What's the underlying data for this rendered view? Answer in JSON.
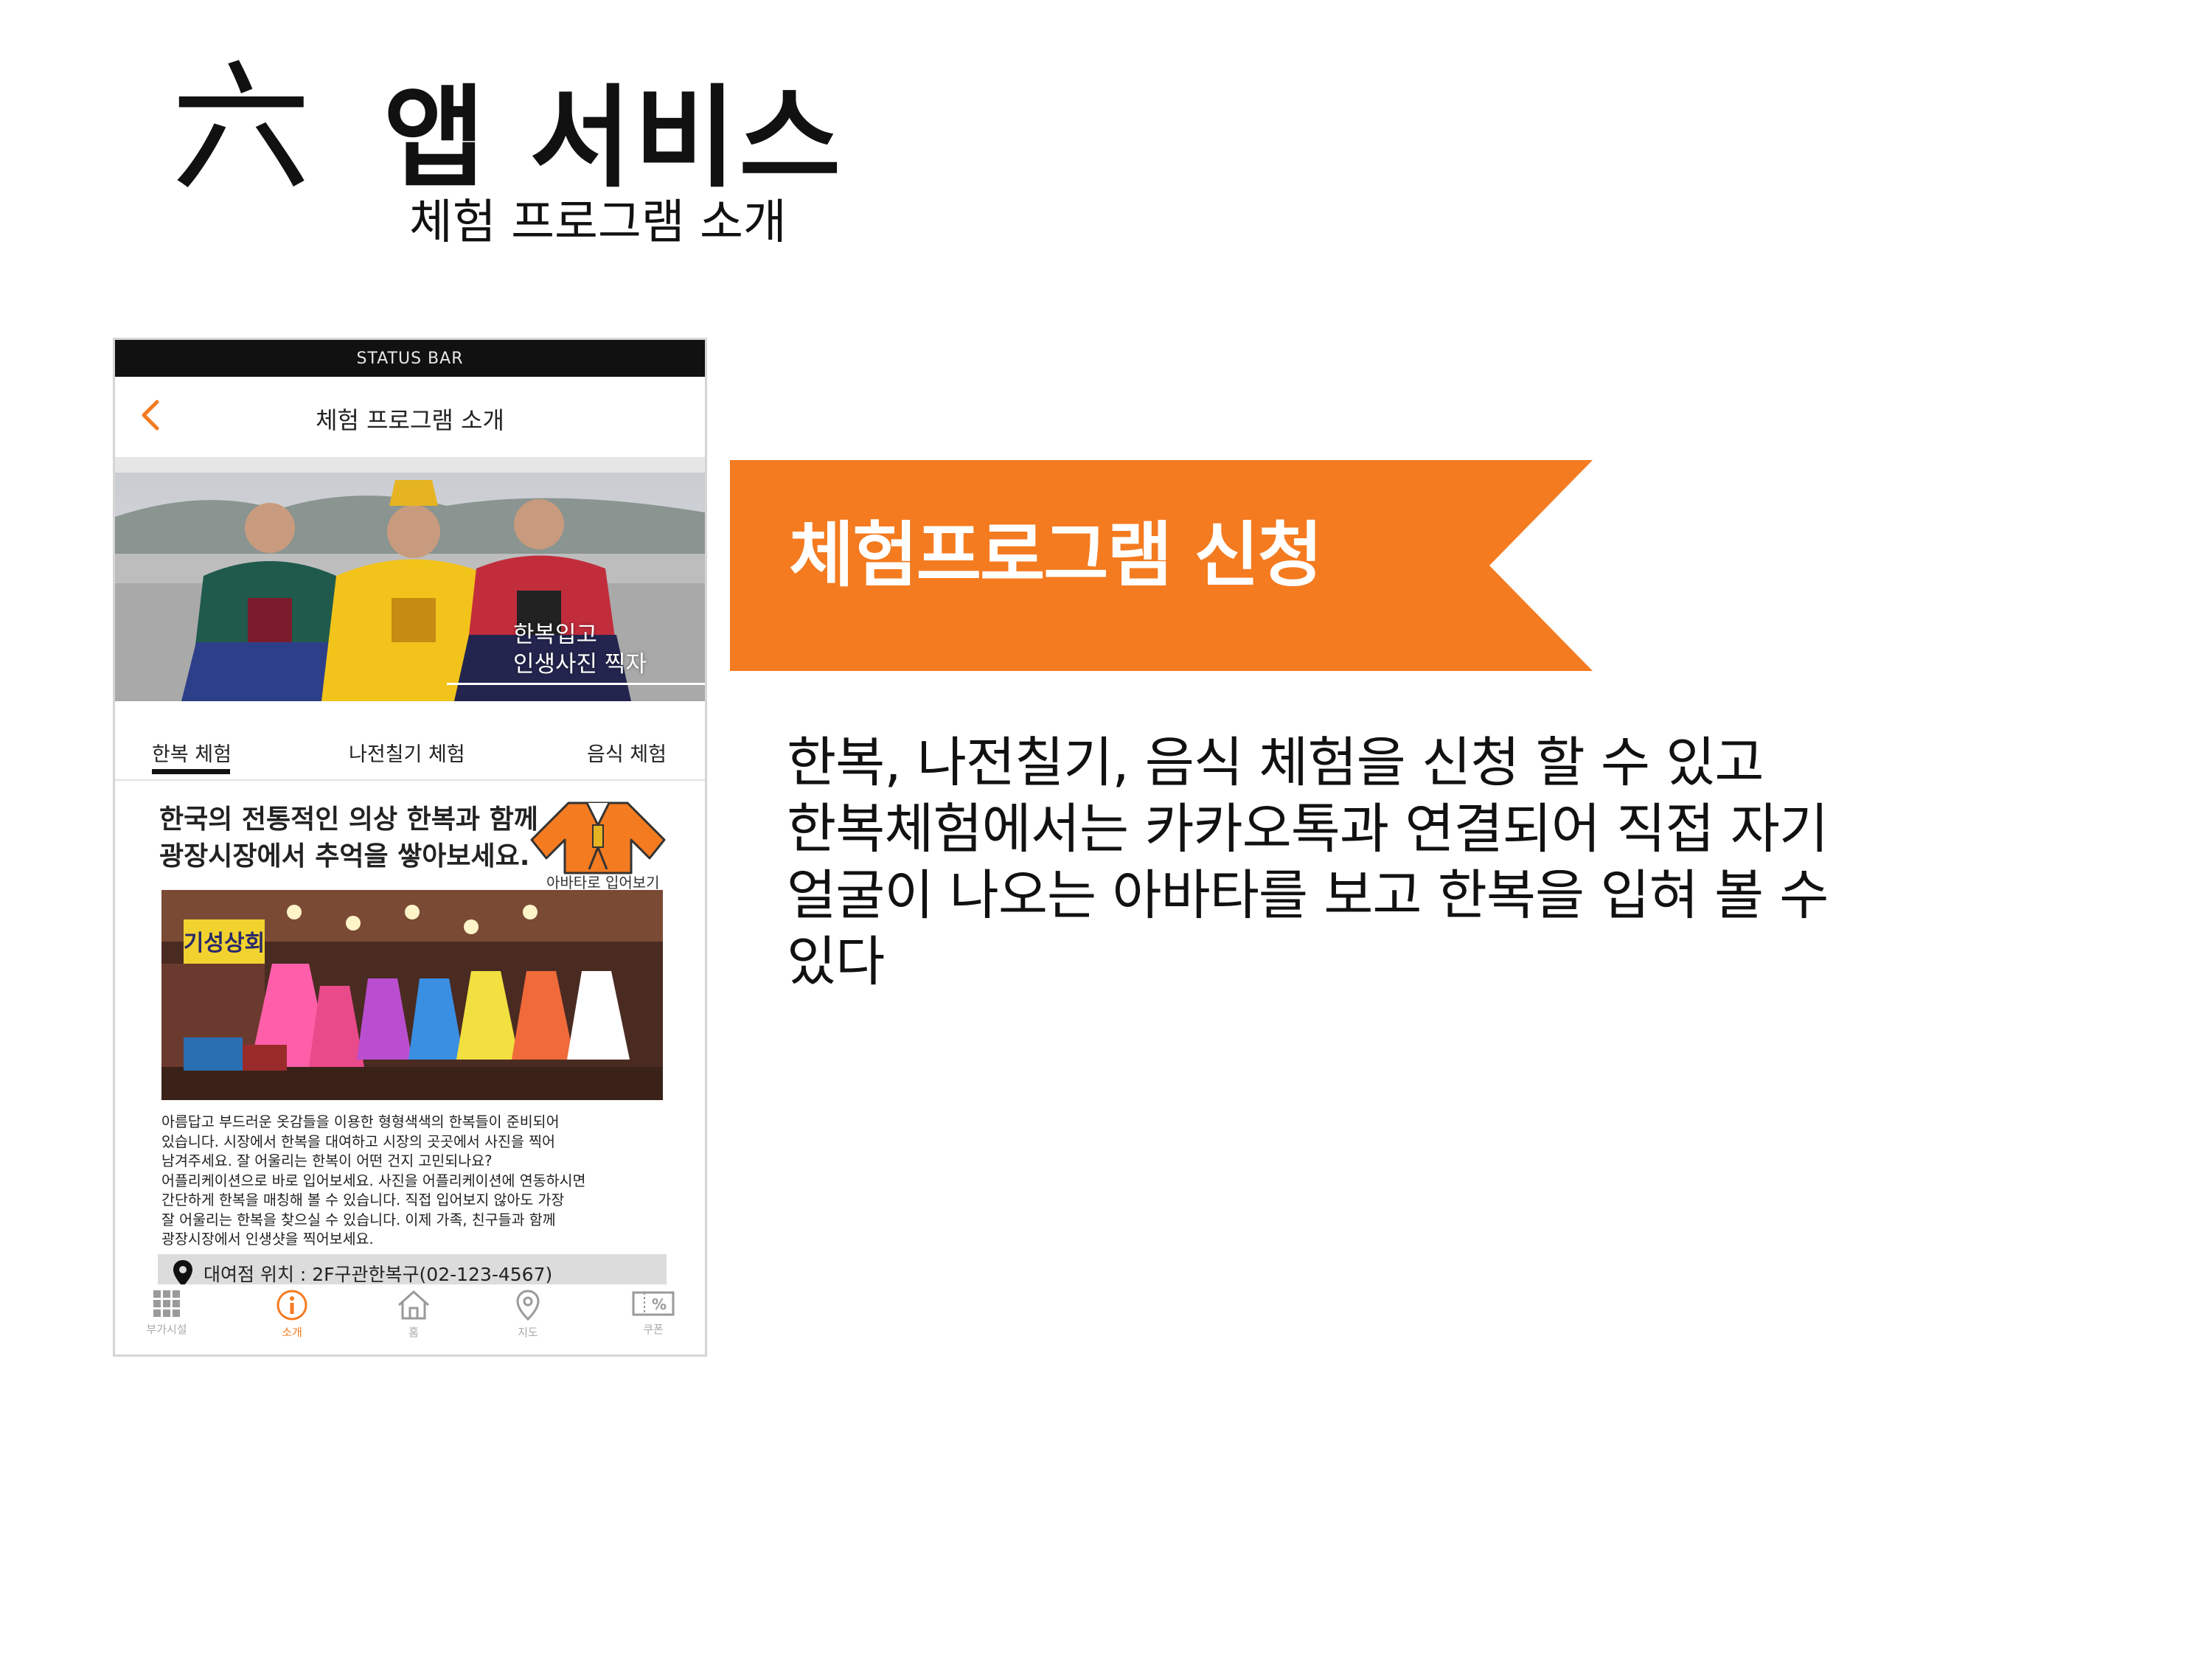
{
  "slide": {
    "numeral": "六",
    "title": "앱 서비스",
    "subtitle": "체험 프로그램 소개"
  },
  "phone": {
    "status_bar": "STATUS BAR",
    "nav_title": "체험 프로그램 소개",
    "hero_caption": [
      "한복입고",
      "인생사진 찍자"
    ],
    "tabs": [
      "한복 체험",
      "나전칠기 체험",
      "음식 체험"
    ],
    "active_tab": "한복 체험",
    "intro_title": [
      "한국의 전통적인 의상 한복과 함께",
      "광장시장에서 추억을 쌓아보세요."
    ],
    "avatar_label": "아바타로 입어보기",
    "shop_sign": "기성상회",
    "body_text": [
      "아름답고 부드러운 옷감들을 이용한 형형색색의 한복들이 준비되어",
      "있습니다. 시장에서 한복을 대여하고 시장의 곳곳에서 사진을 찍어",
      "남겨주세요. 잘 어울리는 한복이 어떤 건지 고민되나요?",
      "어플리케이션으로 바로 입어보세요. 사진을 어플리케이션에 연동하시면",
      "간단하게 한복을 매칭해 볼 수 있습니다. 직접 입어보지 않아도 가장",
      "잘 어울리는 한복을 찾으실 수 있습니다. 이제 가족, 친구들과 함께",
      "광장시장에서 인생샷을 찍어보세요."
    ],
    "location": "대여점 위치 : 2F구관한복구(02-123-4567)",
    "bottom_nav": [
      {
        "label": "부가시설",
        "icon": "grid-icon"
      },
      {
        "label": "소개",
        "icon": "info-icon",
        "active": true
      },
      {
        "label": "홈",
        "icon": "home-icon"
      },
      {
        "label": "지도",
        "icon": "map-pin-icon"
      },
      {
        "label": "쿠폰",
        "icon": "coupon-icon"
      }
    ]
  },
  "ribbon": {
    "text": "체험프로그램 신청",
    "color": "#f47b20"
  },
  "description": [
    "한복, 나전칠기, 음식 체험을 신청 할 수 있고",
    "한복체험에서는 카카오톡과 연결되어 직접 자기",
    "얼굴이 나오는 아바타를 보고 한복을 입혀 볼 수",
    "있다"
  ],
  "colors": {
    "accent": "#f47b20",
    "status_bar": "#111111"
  }
}
